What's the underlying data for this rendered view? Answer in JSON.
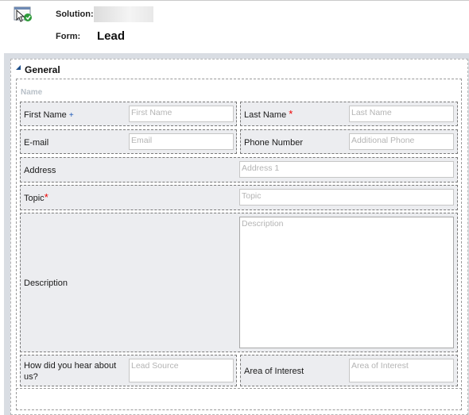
{
  "header": {
    "solution_label": "Solution:",
    "solution_value": "",
    "form_label": "Form:",
    "form_name": "Lead"
  },
  "tab": {
    "title": "General"
  },
  "section": {
    "title": "Name"
  },
  "fields": {
    "first_name": {
      "label": "First Name",
      "marker": "+",
      "placeholder": "First Name"
    },
    "last_name": {
      "label": "Last Name",
      "marker": "*",
      "placeholder": "Last Name"
    },
    "email": {
      "label": "E-mail",
      "placeholder": "Email"
    },
    "phone": {
      "label": "Phone Number",
      "placeholder": "Additional Phone"
    },
    "address": {
      "label": "Address",
      "placeholder": "Address 1"
    },
    "topic": {
      "label": "Topic",
      "marker": "*",
      "placeholder": "Topic"
    },
    "description": {
      "label": "Description",
      "placeholder": "Description"
    },
    "how_heard": {
      "label_line1": "How did you hear about",
      "label_line2": "us?",
      "placeholder": "Lead Source"
    },
    "area_interest": {
      "label": "Area of Interest",
      "placeholder": "Area of Interest"
    }
  }
}
